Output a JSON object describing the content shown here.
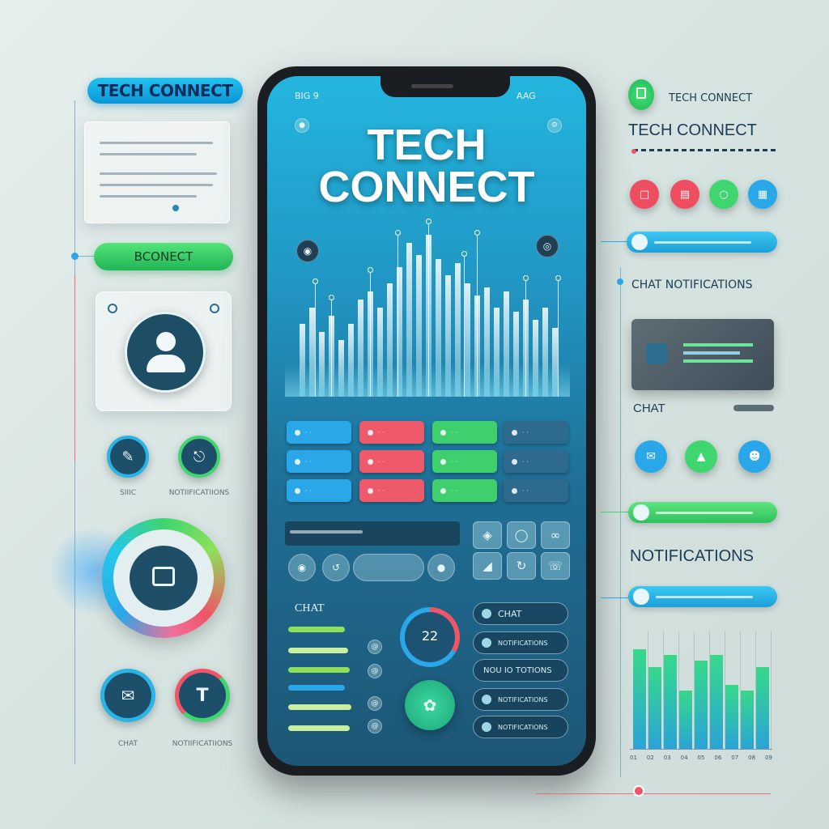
{
  "left_panel": {
    "title_pill": "TECH CONNECT",
    "connect_pill": "BCONECT",
    "icon_labels": [
      "SIIIC",
      "NOTIIFICATIIONS"
    ],
    "bottom_labels": [
      "CHAT",
      "NOTIIFICATIIONS"
    ],
    "icons": [
      "document-icon",
      "user-icon",
      "chat-icon",
      "wifi-icon",
      "chat-bubble-icon",
      "t-icon"
    ]
  },
  "phone": {
    "status_left": "BIG 9",
    "status_right": "AAG",
    "title_line1": "TECH",
    "title_line2": "CONNECT",
    "chat_label": "CHAT",
    "gauge_value": "22",
    "list_items": [
      "CHAT",
      "NOTIFICATIONS",
      "NOU IO TOTIONS",
      "NOTIFICATIONS",
      "NOTIFICATIONS"
    ],
    "grid_colors": [
      "#2aa7e8",
      "#ef5a6a",
      "#3fcf6d",
      "#2e6a8c"
    ]
  },
  "right_panel": {
    "top_tag": "TECH CONNECT",
    "heading": "TECH CONNECT",
    "chat_notifications": "CHAT NOTIFICATIONS",
    "chat": "CHAT",
    "notifications": "NOTIFICATIONS",
    "x_labels": [
      "01",
      "02",
      "03",
      "04",
      "05",
      "06",
      "07",
      "08",
      "09"
    ],
    "bar_heights": [
      0.85,
      0.7,
      0.8,
      0.5,
      0.75,
      0.8,
      0.55,
      0.5,
      0.7
    ]
  },
  "colors": {
    "accent_blue": "#22b4e6",
    "accent_green": "#3fd56f",
    "accent_red": "#ef5566",
    "dark_navy": "#1d4f6b"
  }
}
